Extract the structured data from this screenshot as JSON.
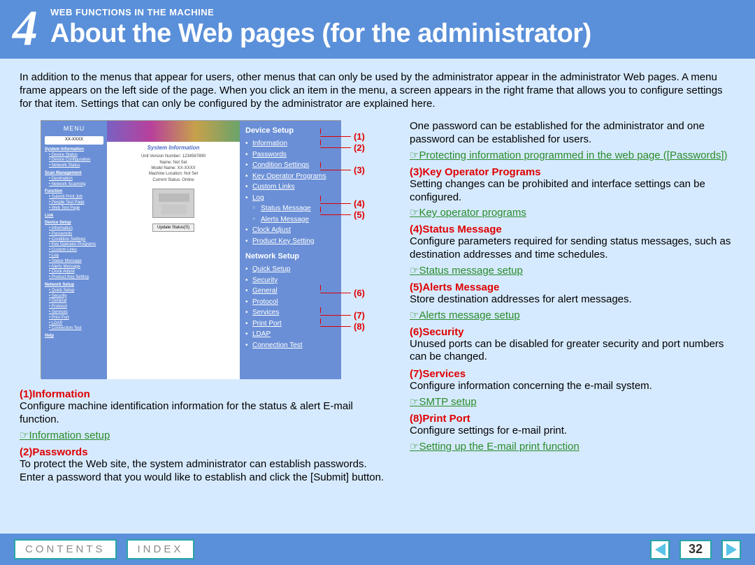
{
  "header": {
    "chapter_number": "4",
    "overline": "WEB FUNCTIONS IN THE MACHINE",
    "title": "About the Web pages (for the administrator)"
  },
  "intro": "In addition to the menus that appear for users, other menus that can only be used by the administrator appear in the administrator Web pages. A menu frame appears on the left side of the page. When you click an item in the menu, a screen appears in the right frame that allows you to configure settings for that item. Settings that can only be configured by the administrator are explained here.",
  "mini_screenshot": {
    "menu_label": "MENU",
    "model": "XX-XXXX",
    "sidebar_sections": [
      {
        "head": "System Information",
        "items": [
          "Device Status",
          "Device Configuration",
          "Network Status"
        ]
      },
      {
        "head": "Scan Management",
        "items": [
          "Destination",
          "Network Scanning"
        ]
      },
      {
        "head": "Function",
        "items": [
          "Submit Print Job",
          "People Test Page",
          "Web Test Page"
        ]
      },
      {
        "head": "Link",
        "items": []
      },
      {
        "head": "Device Setup",
        "items": [
          "Information",
          "Passwords",
          "Condition Settings",
          "Key Operator Programs",
          "Custom Links",
          "Log",
          "Status Message",
          "Alerts Message",
          "Clock Adjust",
          "Product Key Setting"
        ]
      },
      {
        "head": "Network Setup",
        "items": [
          "Quick Setup",
          "Security",
          "General",
          "Protocol",
          "Services",
          "Print Port",
          "LDAP",
          "Connection Test"
        ]
      },
      {
        "head": "Help",
        "items": []
      }
    ],
    "main_label": "System Information",
    "info_lines": [
      "Unit Version Number: 1234567890",
      "Name: Not Set",
      "Model Name: XX-XXXX",
      "Machine Location: Not Set",
      "Current Status: Online"
    ],
    "update_btn": "Update Status(S)",
    "device_setup_head": "Device Setup",
    "device_setup_items": [
      "Information",
      "Passwords",
      "Condition Settings",
      "Key Operator Programs",
      "Custom Links",
      "Log"
    ],
    "device_setup_subitems": [
      "Status Message",
      "Alerts Message"
    ],
    "device_setup_tail": [
      "Clock Adjust",
      "Product Key Setting"
    ],
    "network_setup_head": "Network Setup",
    "network_setup_items": [
      "Quick Setup",
      "Security",
      "General",
      "Protocol",
      "Services",
      "Print Port",
      "LDAP",
      "Connection Test"
    ]
  },
  "callouts": [
    "(1)",
    "(2)",
    "(3)",
    "(4)",
    "(5)",
    "(6)",
    "(7)",
    "(8)"
  ],
  "left_items": [
    {
      "num": "(1)",
      "title": "Information",
      "body": "Configure machine identification information for the status & alert E-mail function.",
      "link": "Information setup"
    },
    {
      "num": "(2)",
      "title": "Passwords",
      "body": "To protect the Web site, the system administrator can establish passwords. Enter a password that you would like to establish and click the [Submit] button.",
      "link": ""
    }
  ],
  "right_pre": "One password can be established for the administrator and one password can be established for users.",
  "right_pre_link": "Protecting information programmed in the web page ([Passwords])",
  "right_items": [
    {
      "num": "(3)",
      "title": "Key Operator Programs",
      "body": "Setting changes can be prohibited and interface settings can be configured.",
      "link": "Key operator programs"
    },
    {
      "num": "(4)",
      "title": "Status Message",
      "body": "Configure parameters required for sending status messages, such as destination addresses and time schedules.",
      "link": "Status message setup"
    },
    {
      "num": "(5)",
      "title": "Alerts Message",
      "body": "Store destination addresses for alert messages.",
      "link": "Alerts message setup"
    },
    {
      "num": "(6)",
      "title": "Security",
      "body": "Unused ports can be disabled for greater security and port numbers can be changed.",
      "link": ""
    },
    {
      "num": "(7)",
      "title": "Services",
      "body": "Configure information concerning the e-mail system.",
      "link": "SMTP setup"
    },
    {
      "num": "(8)",
      "title": "Print Port",
      "body": "Configure settings for e-mail print.",
      "link": "Setting up the E-mail print function"
    }
  ],
  "footer": {
    "contents": "CONTENTS",
    "index": "INDEX",
    "page": "32"
  }
}
